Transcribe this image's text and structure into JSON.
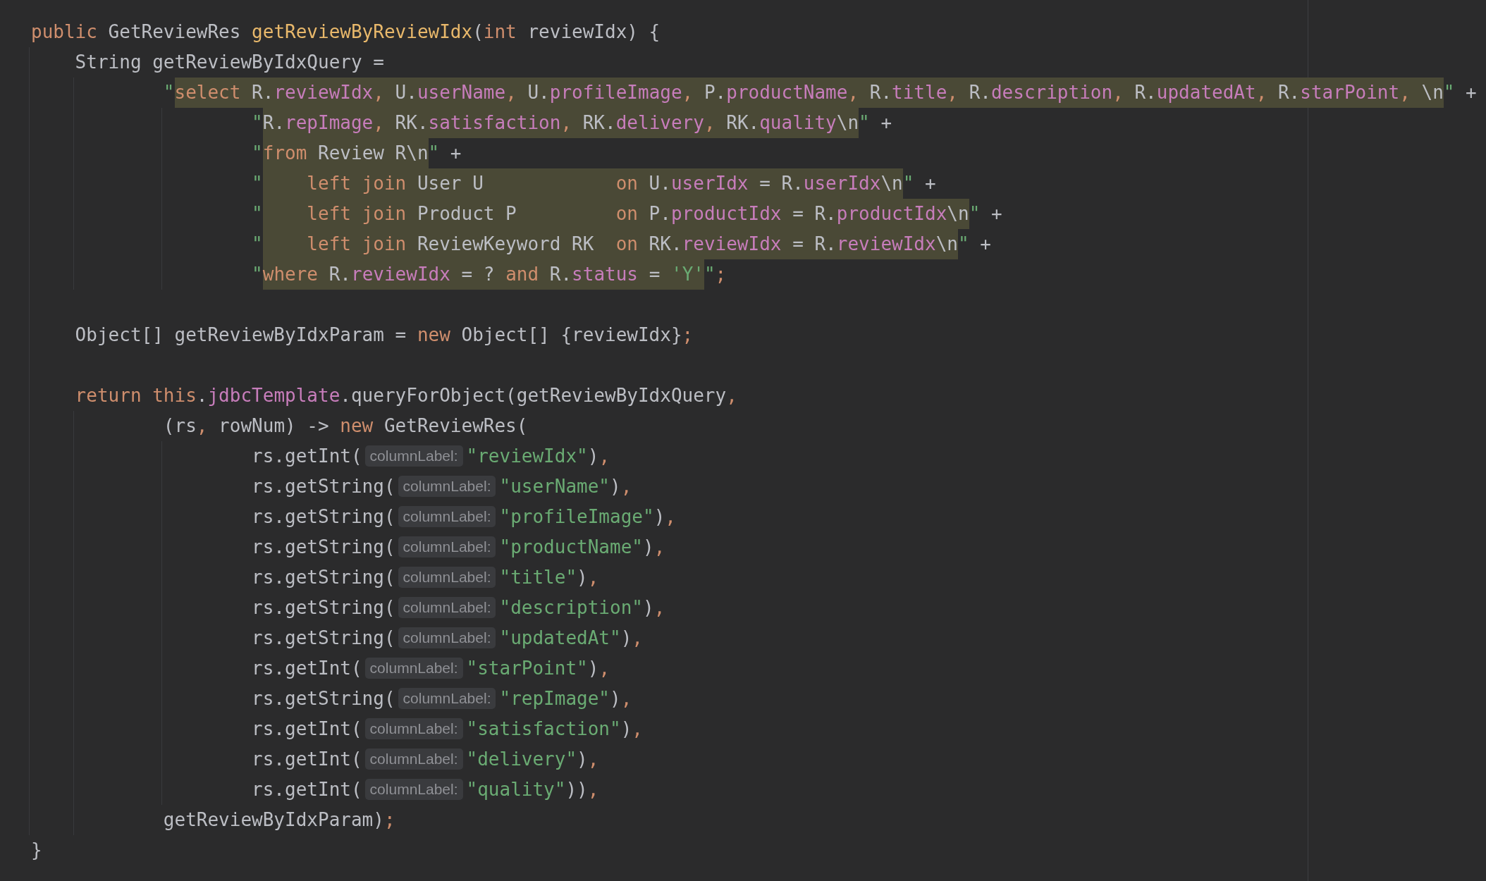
{
  "editor": {
    "lines": [
      {
        "tokens": [
          {
            "kind": "kw",
            "text": "public"
          },
          {
            "kind": "plain",
            "text": " GetReviewRes "
          },
          {
            "kind": "method",
            "text": "getReviewByReviewIdx"
          },
          {
            "kind": "plain",
            "text": "("
          },
          {
            "kind": "kw",
            "text": "int"
          },
          {
            "kind": "plain",
            "text": " reviewIdx) {"
          }
        ]
      },
      {
        "tokens": [
          {
            "kind": "plain",
            "text": "    String getReviewByIdxQuery ="
          }
        ]
      },
      {
        "tokens": [
          {
            "kind": "str",
            "text": "            \""
          },
          {
            "kind": "kw",
            "text": "select",
            "injected": true
          },
          {
            "kind": "plain",
            "text": " R.",
            "injected": true
          },
          {
            "kind": "field",
            "text": "reviewIdx",
            "injected": true
          },
          {
            "kind": "punct",
            "text": ",",
            "injected": true
          },
          {
            "kind": "plain",
            "text": " U.",
            "injected": true
          },
          {
            "kind": "field",
            "text": "userName",
            "injected": true
          },
          {
            "kind": "punct",
            "text": ",",
            "injected": true
          },
          {
            "kind": "plain",
            "text": " U.",
            "injected": true
          },
          {
            "kind": "field",
            "text": "profileImage",
            "injected": true
          },
          {
            "kind": "punct",
            "text": ",",
            "injected": true
          },
          {
            "kind": "plain",
            "text": " P.",
            "injected": true
          },
          {
            "kind": "field",
            "text": "productName",
            "injected": true
          },
          {
            "kind": "punct",
            "text": ",",
            "injected": true
          },
          {
            "kind": "plain",
            "text": " R.",
            "injected": true
          },
          {
            "kind": "field",
            "text": "title",
            "injected": true
          },
          {
            "kind": "punct",
            "text": ",",
            "injected": true
          },
          {
            "kind": "plain",
            "text": " R.",
            "injected": true
          },
          {
            "kind": "field",
            "text": "description",
            "injected": true
          },
          {
            "kind": "punct",
            "text": ",",
            "injected": true
          },
          {
            "kind": "plain",
            "text": " R.",
            "injected": true
          },
          {
            "kind": "field",
            "text": "updatedAt",
            "injected": true
          },
          {
            "kind": "punct",
            "text": ",",
            "injected": true
          },
          {
            "kind": "plain",
            "text": " R.",
            "injected": true
          },
          {
            "kind": "field",
            "text": "starPoint",
            "injected": true
          },
          {
            "kind": "punct",
            "text": ",",
            "injected": true
          },
          {
            "kind": "plain",
            "text": " \\n",
            "injected": true
          },
          {
            "kind": "str",
            "text": "\""
          },
          {
            "kind": "plain",
            "text": " +"
          }
        ]
      },
      {
        "tokens": [
          {
            "kind": "str",
            "text": "                    \""
          },
          {
            "kind": "plain",
            "text": "R.",
            "injected": true
          },
          {
            "kind": "field",
            "text": "repImage",
            "injected": true
          },
          {
            "kind": "punct",
            "text": ",",
            "injected": true
          },
          {
            "kind": "plain",
            "text": " RK.",
            "injected": true
          },
          {
            "kind": "field",
            "text": "satisfaction",
            "injected": true
          },
          {
            "kind": "punct",
            "text": ",",
            "injected": true
          },
          {
            "kind": "plain",
            "text": " RK.",
            "injected": true
          },
          {
            "kind": "field",
            "text": "delivery",
            "injected": true
          },
          {
            "kind": "punct",
            "text": ",",
            "injected": true
          },
          {
            "kind": "plain",
            "text": " RK.",
            "injected": true
          },
          {
            "kind": "field",
            "text": "quality",
            "injected": true
          },
          {
            "kind": "plain",
            "text": "\\n",
            "injected": true
          },
          {
            "kind": "str",
            "text": "\""
          },
          {
            "kind": "plain",
            "text": " +"
          }
        ]
      },
      {
        "tokens": [
          {
            "kind": "str",
            "text": "                    \""
          },
          {
            "kind": "kw",
            "text": "from",
            "injected": true
          },
          {
            "kind": "plain",
            "text": " Review R\\n",
            "injected": true
          },
          {
            "kind": "str",
            "text": "\""
          },
          {
            "kind": "plain",
            "text": " +"
          }
        ]
      },
      {
        "tokens": [
          {
            "kind": "str",
            "text": "                    \""
          },
          {
            "kind": "kw",
            "text": "    left join",
            "injected": true
          },
          {
            "kind": "plain",
            "text": " User U            ",
            "injected": true
          },
          {
            "kind": "kw",
            "text": "on",
            "injected": true
          },
          {
            "kind": "plain",
            "text": " U.",
            "injected": true
          },
          {
            "kind": "field",
            "text": "userIdx",
            "injected": true
          },
          {
            "kind": "plain",
            "text": " = R.",
            "injected": true
          },
          {
            "kind": "field",
            "text": "userIdx",
            "injected": true
          },
          {
            "kind": "plain",
            "text": "\\n",
            "injected": true
          },
          {
            "kind": "str",
            "text": "\""
          },
          {
            "kind": "plain",
            "text": " +"
          }
        ]
      },
      {
        "tokens": [
          {
            "kind": "str",
            "text": "                    \""
          },
          {
            "kind": "kw",
            "text": "    left join",
            "injected": true
          },
          {
            "kind": "plain",
            "text": " Product P         ",
            "injected": true
          },
          {
            "kind": "kw",
            "text": "on",
            "injected": true
          },
          {
            "kind": "plain",
            "text": " P.",
            "injected": true
          },
          {
            "kind": "field",
            "text": "productIdx",
            "injected": true
          },
          {
            "kind": "plain",
            "text": " = R.",
            "injected": true
          },
          {
            "kind": "field",
            "text": "productIdx",
            "injected": true
          },
          {
            "kind": "plain",
            "text": "\\n",
            "injected": true
          },
          {
            "kind": "str",
            "text": "\""
          },
          {
            "kind": "plain",
            "text": " +"
          }
        ]
      },
      {
        "tokens": [
          {
            "kind": "str",
            "text": "                    \""
          },
          {
            "kind": "kw",
            "text": "    left join",
            "injected": true
          },
          {
            "kind": "plain",
            "text": " ReviewKeyword RK  ",
            "injected": true
          },
          {
            "kind": "kw",
            "text": "on",
            "injected": true
          },
          {
            "kind": "plain",
            "text": " RK.",
            "injected": true
          },
          {
            "kind": "field",
            "text": "reviewIdx",
            "injected": true
          },
          {
            "kind": "plain",
            "text": " = R.",
            "injected": true
          },
          {
            "kind": "field",
            "text": "reviewIdx",
            "injected": true
          },
          {
            "kind": "plain",
            "text": "\\n",
            "injected": true
          },
          {
            "kind": "str",
            "text": "\""
          },
          {
            "kind": "plain",
            "text": " +"
          }
        ]
      },
      {
        "tokens": [
          {
            "kind": "str",
            "text": "                    \""
          },
          {
            "kind": "kw",
            "text": "where",
            "injected": true
          },
          {
            "kind": "plain",
            "text": " R.",
            "injected": true
          },
          {
            "kind": "field",
            "text": "reviewIdx",
            "injected": true
          },
          {
            "kind": "plain",
            "text": " = ? ",
            "injected": true
          },
          {
            "kind": "kw",
            "text": "and",
            "injected": true
          },
          {
            "kind": "plain",
            "text": " R.",
            "injected": true
          },
          {
            "kind": "field",
            "text": "status",
            "injected": true
          },
          {
            "kind": "plain",
            "text": " = ",
            "injected": true
          },
          {
            "kind": "str",
            "text": "'Y'",
            "injected": true
          },
          {
            "kind": "str",
            "text": "\""
          },
          {
            "kind": "punct",
            "text": ";"
          }
        ]
      },
      {
        "kind": "blank"
      },
      {
        "tokens": [
          {
            "kind": "plain",
            "text": "    Object[] getReviewByIdxParam = "
          },
          {
            "kind": "kw",
            "text": "new"
          },
          {
            "kind": "plain",
            "text": " Object[] {reviewIdx}"
          },
          {
            "kind": "punct",
            "text": ";"
          }
        ]
      },
      {
        "kind": "blank"
      },
      {
        "tokens": [
          {
            "kind": "kw",
            "text": "    return "
          },
          {
            "kind": "kw",
            "text": "this"
          },
          {
            "kind": "plain",
            "text": "."
          },
          {
            "kind": "field",
            "text": "jdbcTemplate"
          },
          {
            "kind": "plain",
            "text": ".queryForObject(getReviewByIdxQuery"
          },
          {
            "kind": "punct",
            "text": ","
          }
        ]
      },
      {
        "tokens": [
          {
            "kind": "plain",
            "text": "            (rs"
          },
          {
            "kind": "punct",
            "text": ","
          },
          {
            "kind": "plain",
            "text": " rowNum) -> "
          },
          {
            "kind": "kw",
            "text": "new"
          },
          {
            "kind": "plain",
            "text": " GetReviewRes("
          }
        ]
      },
      {
        "tokens": [
          {
            "kind": "plain",
            "text": "                    rs.getInt("
          },
          {
            "kind": "hint",
            "text": "columnLabel:"
          },
          {
            "kind": "str",
            "text": "\"reviewIdx\""
          },
          {
            "kind": "plain",
            "text": ")"
          },
          {
            "kind": "punct",
            "text": ","
          }
        ]
      },
      {
        "tokens": [
          {
            "kind": "plain",
            "text": "                    rs.getString("
          },
          {
            "kind": "hint",
            "text": "columnLabel:"
          },
          {
            "kind": "str",
            "text": "\"userName\""
          },
          {
            "kind": "plain",
            "text": ")"
          },
          {
            "kind": "punct",
            "text": ","
          }
        ]
      },
      {
        "tokens": [
          {
            "kind": "plain",
            "text": "                    rs.getString("
          },
          {
            "kind": "hint",
            "text": "columnLabel:"
          },
          {
            "kind": "str",
            "text": "\"profileImage\""
          },
          {
            "kind": "plain",
            "text": ")"
          },
          {
            "kind": "punct",
            "text": ","
          }
        ]
      },
      {
        "tokens": [
          {
            "kind": "plain",
            "text": "                    rs.getString("
          },
          {
            "kind": "hint",
            "text": "columnLabel:"
          },
          {
            "kind": "str",
            "text": "\"productName\""
          },
          {
            "kind": "plain",
            "text": ")"
          },
          {
            "kind": "punct",
            "text": ","
          }
        ]
      },
      {
        "tokens": [
          {
            "kind": "plain",
            "text": "                    rs.getString("
          },
          {
            "kind": "hint",
            "text": "columnLabel:"
          },
          {
            "kind": "str",
            "text": "\"title\""
          },
          {
            "kind": "plain",
            "text": ")"
          },
          {
            "kind": "punct",
            "text": ","
          }
        ]
      },
      {
        "tokens": [
          {
            "kind": "plain",
            "text": "                    rs.getString("
          },
          {
            "kind": "hint",
            "text": "columnLabel:"
          },
          {
            "kind": "str",
            "text": "\"description\""
          },
          {
            "kind": "plain",
            "text": ")"
          },
          {
            "kind": "punct",
            "text": ","
          }
        ]
      },
      {
        "tokens": [
          {
            "kind": "plain",
            "text": "                    rs.getString("
          },
          {
            "kind": "hint",
            "text": "columnLabel:"
          },
          {
            "kind": "str",
            "text": "\"updatedAt\""
          },
          {
            "kind": "plain",
            "text": ")"
          },
          {
            "kind": "punct",
            "text": ","
          }
        ]
      },
      {
        "tokens": [
          {
            "kind": "plain",
            "text": "                    rs.getInt("
          },
          {
            "kind": "hint",
            "text": "columnLabel:"
          },
          {
            "kind": "str",
            "text": "\"starPoint\""
          },
          {
            "kind": "plain",
            "text": ")"
          },
          {
            "kind": "punct",
            "text": ","
          }
        ]
      },
      {
        "tokens": [
          {
            "kind": "plain",
            "text": "                    rs.getString("
          },
          {
            "kind": "hint",
            "text": "columnLabel:"
          },
          {
            "kind": "str",
            "text": "\"repImage\""
          },
          {
            "kind": "plain",
            "text": ")"
          },
          {
            "kind": "punct",
            "text": ","
          }
        ]
      },
      {
        "tokens": [
          {
            "kind": "plain",
            "text": "                    rs.getInt("
          },
          {
            "kind": "hint",
            "text": "columnLabel:"
          },
          {
            "kind": "str",
            "text": "\"satisfaction\""
          },
          {
            "kind": "plain",
            "text": ")"
          },
          {
            "kind": "punct",
            "text": ","
          }
        ]
      },
      {
        "tokens": [
          {
            "kind": "plain",
            "text": "                    rs.getInt("
          },
          {
            "kind": "hint",
            "text": "columnLabel:"
          },
          {
            "kind": "str",
            "text": "\"delivery\""
          },
          {
            "kind": "plain",
            "text": ")"
          },
          {
            "kind": "punct",
            "text": ","
          }
        ]
      },
      {
        "tokens": [
          {
            "kind": "plain",
            "text": "                    rs.getInt("
          },
          {
            "kind": "hint",
            "text": "columnLabel:"
          },
          {
            "kind": "str",
            "text": "\"quality\""
          },
          {
            "kind": "plain",
            "text": "))"
          },
          {
            "kind": "punct",
            "text": ","
          }
        ]
      },
      {
        "tokens": [
          {
            "kind": "plain",
            "text": "            getReviewByIdxParam)"
          },
          {
            "kind": "punct",
            "text": ";"
          }
        ]
      },
      {
        "tokens": [
          {
            "kind": "plain",
            "text": "}"
          }
        ]
      }
    ]
  }
}
